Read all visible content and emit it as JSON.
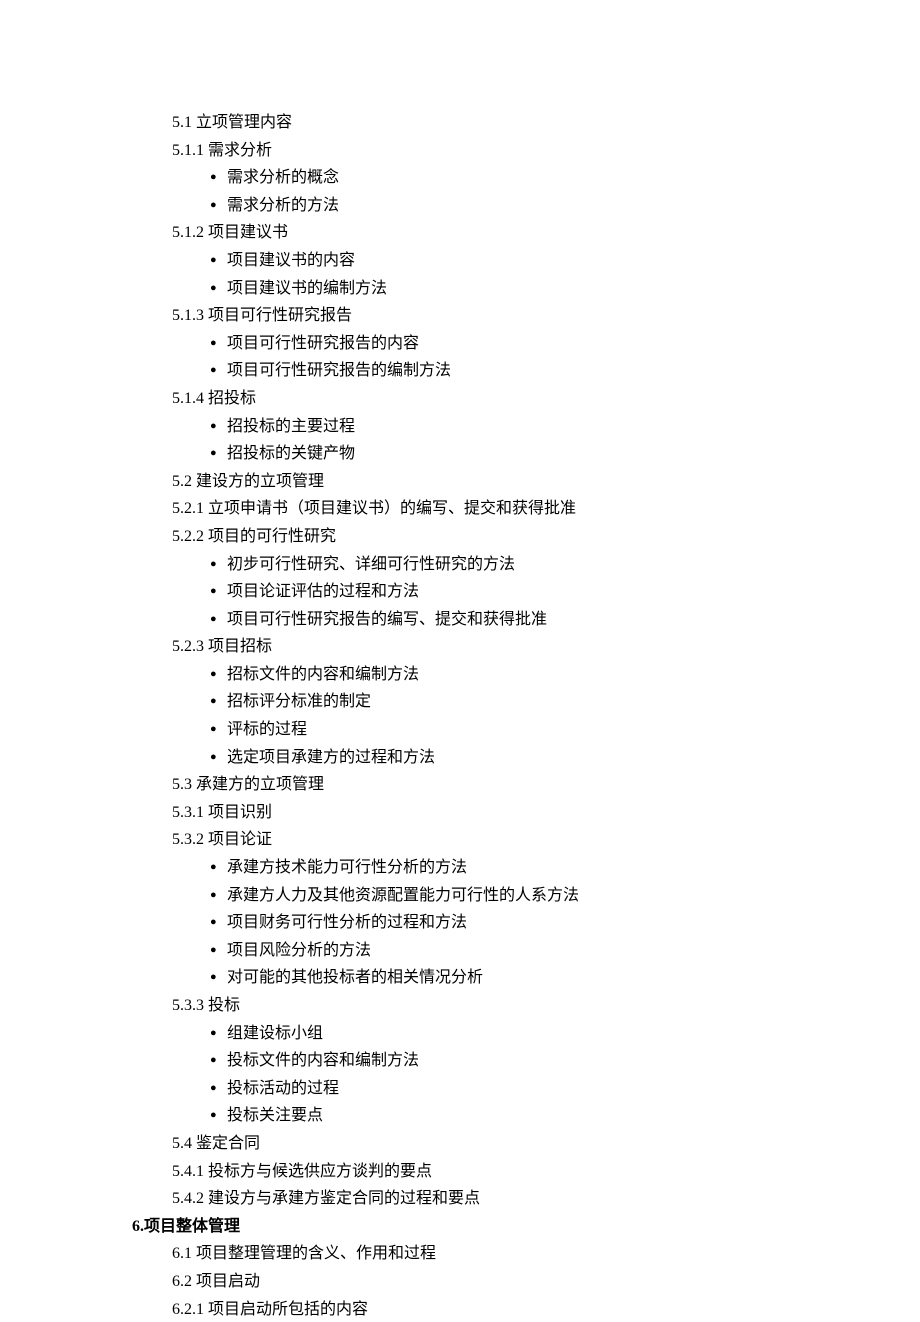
{
  "sections": {
    "s5_1": "5.1 立项管理内容",
    "s5_1_1": "5.1.1 需求分析",
    "s5_1_1_b1": "需求分析的概念",
    "s5_1_1_b2": "需求分析的方法",
    "s5_1_2": "5.1.2 项目建议书",
    "s5_1_2_b1": "项目建议书的内容",
    "s5_1_2_b2": "项目建议书的编制方法",
    "s5_1_3": "5.1.3 项目可行性研究报告",
    "s5_1_3_b1": "项目可行性研究报告的内容",
    "s5_1_3_b2": "项目可行性研究报告的编制方法",
    "s5_1_4": "5.1.4 招投标",
    "s5_1_4_b1": "招投标的主要过程",
    "s5_1_4_b2": "招投标的关键产物",
    "s5_2": "5.2 建设方的立项管理",
    "s5_2_1": "5.2.1 立项申请书（项目建议书）的编写、提交和获得批准",
    "s5_2_2": "5.2.2 项目的可行性研究",
    "s5_2_2_b1": "初步可行性研究、详细可行性研究的方法",
    "s5_2_2_b2": "项目论证评估的过程和方法",
    "s5_2_2_b3": "项目可行性研究报告的编写、提交和获得批准",
    "s5_2_3": "5.2.3 项目招标",
    "s5_2_3_b1": "招标文件的内容和编制方法",
    "s5_2_3_b2": "招标评分标准的制定",
    "s5_2_3_b3": "评标的过程",
    "s5_2_3_b4": "选定项目承建方的过程和方法",
    "s5_3": "5.3 承建方的立项管理",
    "s5_3_1": "5.3.1 项目识别",
    "s5_3_2": "5.3.2 项目论证",
    "s5_3_2_b1": "承建方技术能力可行性分析的方法",
    "s5_3_2_b2": "承建方人力及其他资源配置能力可行性的人系方法",
    "s5_3_2_b3": "项目财务可行性分析的过程和方法",
    "s5_3_2_b4": "项目风险分析的方法",
    "s5_3_2_b5": "对可能的其他投标者的相关情况分析",
    "s5_3_3": "5.3.3 投标",
    "s5_3_3_b1": "组建设标小组",
    "s5_3_3_b2": "投标文件的内容和编制方法",
    "s5_3_3_b3": "投标活动的过程",
    "s5_3_3_b4": "投标关注要点",
    "s5_4": "5.4 鉴定合同",
    "s5_4_1": "5.4.1 投标方与候选供应方谈判的要点",
    "s5_4_2": "5.4.2 建设方与承建方鉴定合同的过程和要点",
    "h6": "6.项目整体管理",
    "s6_1": "6.1 项目整理管理的含义、作用和过程",
    "s6_2": "6.2 项目启动",
    "s6_2_1": "6.2.1 项目启动所包括的内容"
  }
}
